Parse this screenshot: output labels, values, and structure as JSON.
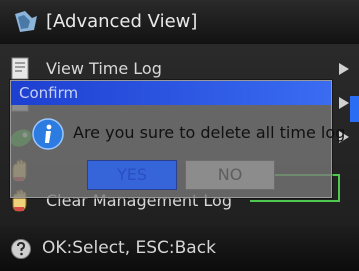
{
  "header": {
    "title": "[Advanced View]",
    "icon": "advanced-view-icon"
  },
  "menu": {
    "items": [
      {
        "label": "View Time Log",
        "icon": "document-icon"
      },
      {
        "label": "",
        "icon": "document-icon"
      },
      {
        "label": "",
        "icon": "green-key-icon"
      },
      {
        "label": "",
        "icon": "hand-icon"
      },
      {
        "label": "Clear Management Log",
        "icon": "hand-icon"
      }
    ]
  },
  "dialog": {
    "title": "Confirm",
    "message": "Are you sure to delete all time log",
    "yes_label": "YES",
    "no_label": "NO",
    "icon": "info-icon"
  },
  "status": {
    "text": "OK:Select, ESC:Back",
    "icon": "help-icon"
  },
  "colors": {
    "dialog_titlebar": "#2a56e0",
    "selection_bar": "#2a6df5",
    "highlight_frame": "#4fc84f"
  }
}
